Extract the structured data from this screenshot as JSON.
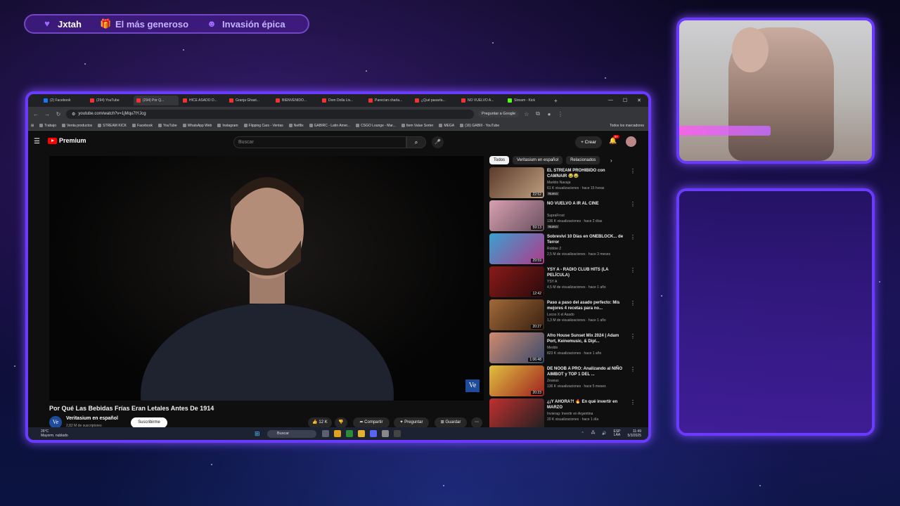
{
  "alert_bar": {
    "items": [
      {
        "icon": "heart-icon",
        "label": "Jxtah"
      },
      {
        "icon": "gift-icon",
        "label": "El más generoso"
      },
      {
        "icon": "raid-icon",
        "label": "Invasión épica"
      }
    ]
  },
  "browser": {
    "tabs": [
      {
        "label": "(2) Facebook",
        "icon": "facebook"
      },
      {
        "label": "(294) YouTube",
        "icon": "youtube"
      },
      {
        "label": "(294) Por Q...",
        "icon": "youtube",
        "active": true
      },
      {
        "label": "HICE ASADO D...",
        "icon": "youtube"
      },
      {
        "label": "Granja Ghast...",
        "icon": "youtube"
      },
      {
        "label": "BIENVENIDO...",
        "icon": "youtube"
      },
      {
        "label": "Dom Dolla Liv...",
        "icon": "youtube"
      },
      {
        "label": "Parecían charla...",
        "icon": "youtube"
      },
      {
        "label": "¿Qué pasaría...",
        "icon": "youtube"
      },
      {
        "label": "NO VUELVO A...",
        "icon": "youtube"
      },
      {
        "label": "Stream - Kick",
        "icon": "kick"
      }
    ],
    "url": "youtube.com/watch?v=1jMqu7tYJcg",
    "ask_google": "Preguntar a Google",
    "bookmarks": [
      "Trabajo",
      "Venta productos",
      "STREAM KICK",
      "Facebook",
      "YouTube",
      "WhatsApp Web",
      "Instagram",
      "Flipping Cars - Ventas",
      "Netflix",
      "GABIRC - Latin Amer...",
      "CSGO Lounge - Mar...",
      "Item Value Sorter",
      "MEGA",
      "(16) GABIII - YouTube"
    ],
    "bookmarks_right": "Todos los marcadores"
  },
  "youtube": {
    "logo": "Premium",
    "search_placeholder": "Buscar",
    "crear_label": "+ Crear",
    "bell_badge": "9+",
    "video_title": "Por Qué Las Bebidas Frías Eran Letales Antes De 1914",
    "channel_name": "Veritasium en español",
    "channel_initials": "Ve",
    "subscribers": "2,82 M de suscriptores",
    "subscribe_label": "Suscribirme",
    "likes": "12 K",
    "share_label": "Compartir",
    "ask_label": "Preguntar",
    "save_label": "Guardar",
    "chips": [
      "Todos",
      "Veritasium en español",
      "Relacionados"
    ],
    "recommendations": [
      {
        "title": "EL STREAM PROHIBIDO con CAMNAIR 😂😂",
        "channel": "Markito Navaja",
        "views": "61 K visualizaciones · hace 15 horas",
        "duration": "22:52",
        "badge": "Nuevo",
        "thumb": [
          "#5a3a2a",
          "#c0a080"
        ]
      },
      {
        "title": "NO VUELVO A IR AL CINE",
        "channel": "SupraFrost",
        "views": "136 K visualizaciones · hace 2 días",
        "duration": "59:13",
        "badge": "Nuevo",
        "thumb": [
          "#d8a0b0",
          "#6a5060"
        ]
      },
      {
        "title": "Sobreviví 10 Días en ONEBLOCK... de Terror",
        "channel": "Robbie Z",
        "views": "2,5 M de visualizaciones · hace 3 meses",
        "duration": "29:59",
        "badge": "",
        "thumb": [
          "#3aa0d0",
          "#b03a8a"
        ]
      },
      {
        "title": "YSY A - RADIO CLUB HITS (LA PELÍCULA)",
        "channel": "YSY A",
        "views": "4,5 M de visualizaciones · hace 1 año",
        "duration": "12:42",
        "badge": "",
        "thumb": [
          "#8a1a1a",
          "#2a0a0a"
        ]
      },
      {
        "title": "Paso a paso del asado perfecto: Mis mejores 4 recetas para no...",
        "channel": "Locos X el Asado",
        "views": "1,3 M de visualizaciones · hace 1 año",
        "duration": "20:27",
        "badge": "",
        "thumb": [
          "#a06a3a",
          "#3a2010"
        ]
      },
      {
        "title": "Afro House Sunset Mix 2024 | Adam Port, Keinemusic, & Dipl...",
        "channel": "Meddo",
        "views": "823 K visualizaciones · hace 1 año",
        "duration": "1:06:48",
        "badge": "",
        "thumb": [
          "#d08a70",
          "#3a4a6a"
        ]
      },
      {
        "title": "DE NOOB A PRO: Analizando al NIÑO AIMBOT y TOP 1 DEL ...",
        "channel": "Zeanus",
        "views": "136 K visualizaciones · hace 5 meses",
        "duration": "20:23",
        "badge": "",
        "thumb": [
          "#e0c040",
          "#a02020"
        ]
      },
      {
        "title": "¿¡Y AHORA?! 🔥 En qué invertir en MARZO",
        "channel": "Invierag: Invertir en Argentina",
        "views": "20 K visualizaciones · hace 1 día",
        "duration": "",
        "badge": "",
        "thumb": [
          "#c03030",
          "#202020"
        ]
      }
    ]
  },
  "taskbar": {
    "weather_temp": "26°C",
    "weather_desc": "Mayorm. nublado",
    "search_label": "Buscar",
    "lang": "ESP",
    "lang2": "LAA",
    "time": "11:49",
    "date": "5/3/2025"
  },
  "colors": {
    "frame_border": "#6a3bff",
    "youtube_red": "#ff0000",
    "accent_purple": "#9d6bff"
  }
}
